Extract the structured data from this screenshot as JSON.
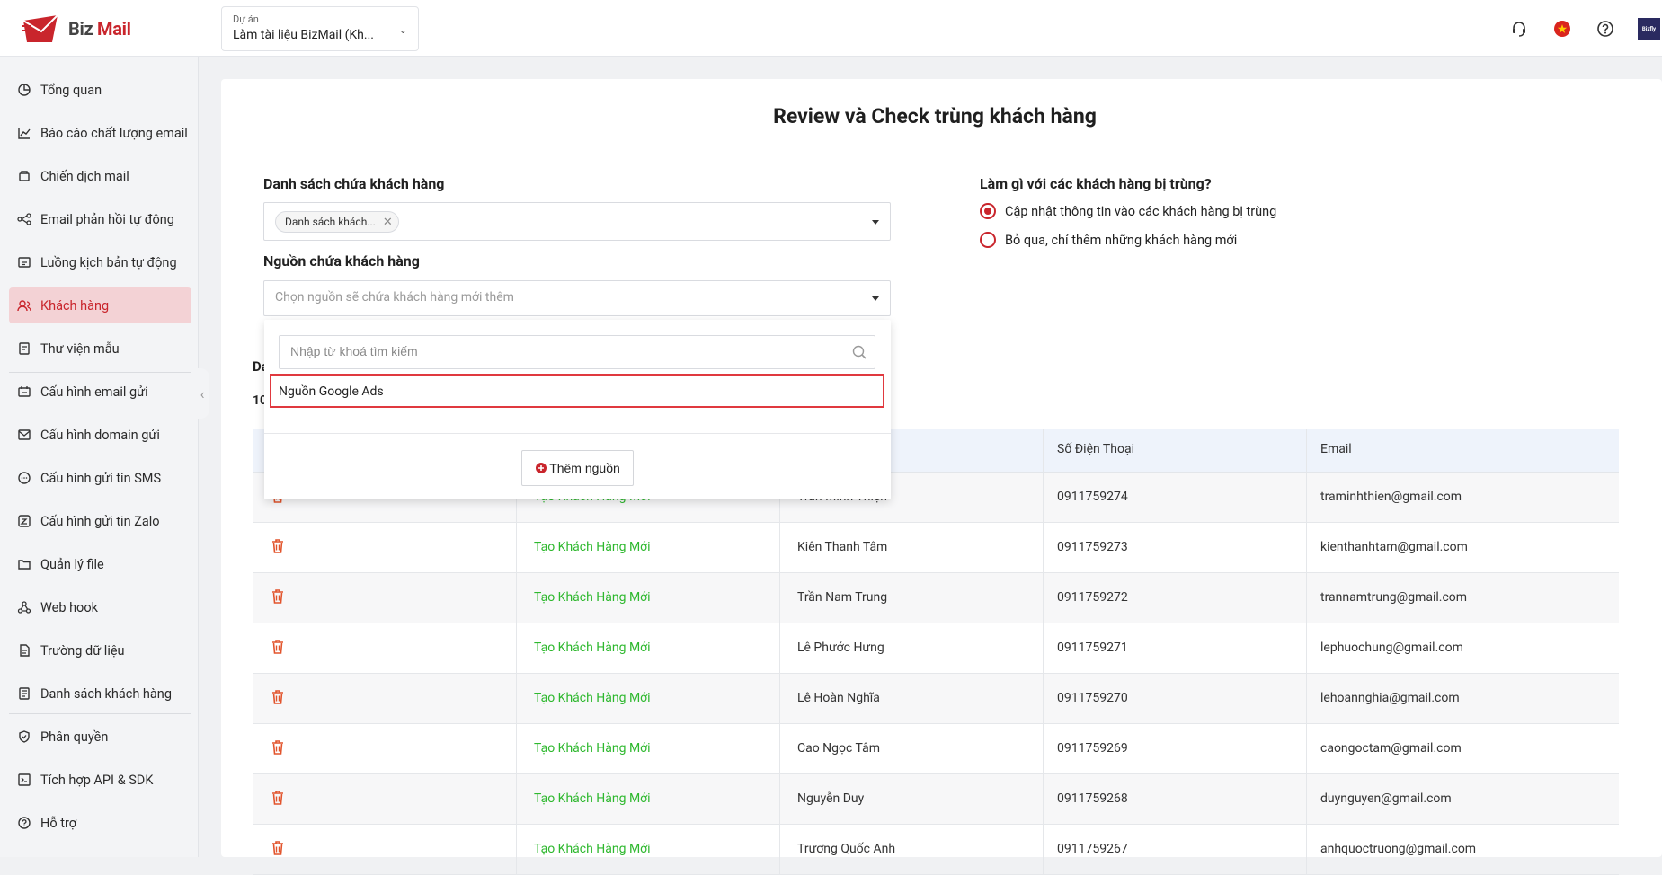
{
  "header": {
    "logo_text_left": "Biz",
    "logo_text_right": "Mail",
    "project_caption": "Dự án",
    "project_value": "Làm tài liệu BizMail (Kh...",
    "avatar_text": "Bizfly"
  },
  "sidebar": {
    "items": [
      {
        "label": "Tổng quan",
        "icon": "pie-chart-icon"
      },
      {
        "label": "Báo cáo chất lượng email",
        "icon": "line-chart-icon"
      },
      {
        "label": "Chiến dịch mail",
        "icon": "campaign-icon"
      },
      {
        "label": "Email phản hồi tự động",
        "icon": "autoresponder-icon"
      },
      {
        "label": "Luồng kịch bản tự động",
        "icon": "workflow-icon"
      },
      {
        "label": "Khách hàng",
        "icon": "customers-icon",
        "active": true
      },
      {
        "label": "Thư viện mẫu",
        "icon": "template-icon"
      },
      {
        "label": "Cấu hình email gửi",
        "icon": "sender-config-icon"
      },
      {
        "label": "Cấu hình domain gửi",
        "icon": "domain-mail-icon"
      },
      {
        "label": "Cấu hình gửi tin SMS",
        "icon": "sms-icon"
      },
      {
        "label": "Cấu hình gửi tin Zalo",
        "icon": "zalo-icon"
      },
      {
        "label": "Quản lý file",
        "icon": "folder-icon"
      },
      {
        "label": "Web hook",
        "icon": "webhook-icon"
      },
      {
        "label": "Trường dữ liệu",
        "icon": "data-field-icon"
      },
      {
        "label": "Danh sách khách hàng",
        "icon": "list-icon"
      },
      {
        "label": "Phân quyền",
        "icon": "shield-icon"
      },
      {
        "label": "Tích hợp API & SDK",
        "icon": "api-icon"
      },
      {
        "label": "Hỗ trợ",
        "icon": "help-icon"
      }
    ]
  },
  "page": {
    "title": "Review và Check trùng khách hàng",
    "list_label": "Danh sách chứa khách hàng",
    "list_tag": "Danh sách khách...",
    "source_label": "Nguồn chứa khách hàng",
    "source_placeholder": "Chọn nguồn sẽ chứa khách hàng mới thêm",
    "duplicate_question": "Làm gì với các khách hàng bị trùng?",
    "duplicate_options": [
      {
        "label": "Cập nhật thông tin vào các khách hàng bị trùng",
        "selected": true
      },
      {
        "label": "Bỏ qua, chỉ thêm những khách hàng mới",
        "selected": false
      }
    ],
    "partial_label_1": "Da",
    "partial_label_2": "10"
  },
  "dropdown": {
    "search_placeholder": "Nhập từ khoá tìm kiếm",
    "options": [
      "Nguồn Google Ads"
    ],
    "add_button": "Thêm nguồn"
  },
  "table": {
    "headers": [
      "",
      "",
      "",
      "Số Điện Thoại",
      "Email"
    ],
    "rows": [
      {
        "status": "Tạo Khách Hàng Mới",
        "name": "Trần Minh Thiện",
        "phone": "0911759274",
        "email": "traminhthien@gmail.com"
      },
      {
        "status": "Tạo Khách Hàng Mới",
        "name": "Kiên Thanh Tâm",
        "phone": "0911759273",
        "email": "kienthanhtam@gmail.com"
      },
      {
        "status": "Tạo Khách Hàng Mới",
        "name": "Trần Nam Trung",
        "phone": "0911759272",
        "email": "trannamtrung@gmail.com"
      },
      {
        "status": "Tạo Khách Hàng Mới",
        "name": "Lê Phước Hưng",
        "phone": "0911759271",
        "email": "lephuochung@gmail.com"
      },
      {
        "status": "Tạo Khách Hàng Mới",
        "name": "Lê Hoàn Nghĩa",
        "phone": "0911759270",
        "email": "lehoannghia@gmail.com"
      },
      {
        "status": "Tạo Khách Hàng Mới",
        "name": "Cao Ngọc Tâm",
        "phone": "0911759269",
        "email": "caongoctam@gmail.com"
      },
      {
        "status": "Tạo Khách Hàng Mới",
        "name": "Nguyễn Duy",
        "phone": "0911759268",
        "email": "duynguyen@gmail.com"
      },
      {
        "status": "Tạo Khách Hàng Mới",
        "name": "Trương Quốc Anh",
        "phone": "0911759267",
        "email": "anhquoctruong@gmail.com"
      }
    ]
  },
  "colors": {
    "brand": "#c9252c",
    "status_green": "#2eb82e",
    "active_nav_bg": "#f3d2d5"
  }
}
